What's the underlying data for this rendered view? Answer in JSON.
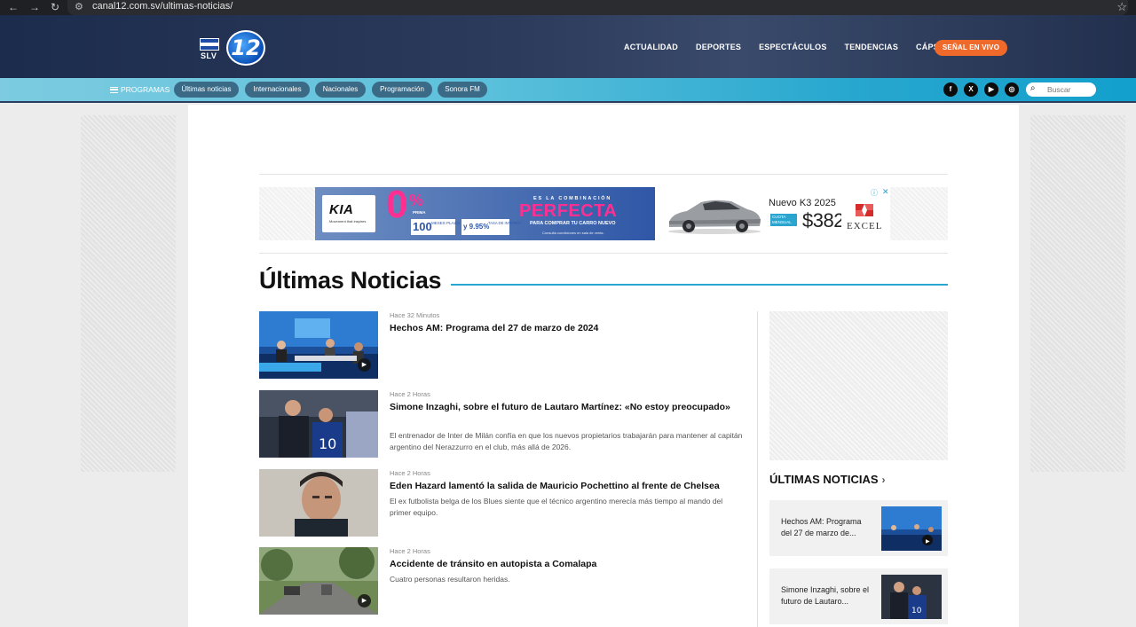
{
  "browser": {
    "url": "canal12.com.sv/ultimas-noticias/"
  },
  "header": {
    "flag_label": "SLV",
    "logo_text": "12",
    "nav": [
      "ACTUALIDAD",
      "DEPORTES",
      "ESPECTÁCULOS",
      "TENDENCIAS",
      "CÁPSULAS"
    ],
    "live_button": "SEÑAL EN VIVO"
  },
  "subnav": {
    "programas": "PROGRAMAS",
    "pills": [
      "Últimas noticias",
      "Internacionales",
      "Nacionales",
      "Programación",
      "Sonora FM"
    ],
    "social": [
      "facebook-icon",
      "x-icon",
      "youtube-icon",
      "instagram-icon"
    ],
    "search_placeholder": "Buscar"
  },
  "banner_ad": {
    "brand": "KIA",
    "brand_sub": "Movement that inspires",
    "zero": "0",
    "percent": "%",
    "prima": "PRIMA ",
    "cuotas": "100",
    "cuotas_sub": "MESES PLAZO",
    "tasa": "y 9.95%",
    "tasa_sub": "TASA DE INTERÉS",
    "es_la": "ES LA COMBINACIÓN",
    "perfecta": "PERFECTA",
    "comprar": "PARA COMPRAR TU CARRO NUEVO",
    "consulta": "Consulta condiciones en sala de venta.",
    "model": "Nuevo K3 2025",
    "cuota_tag": "CUOTA MENSUAL",
    "price": "$382",
    "dealer": "EXCEL"
  },
  "section": {
    "title": "Últimas Noticias"
  },
  "news": [
    {
      "meta": "Hace 32 Minutos",
      "title": "Hechos AM: Programa del 27 de marzo de 2024",
      "desc": ""
    },
    {
      "meta": "Hace 2 Horas",
      "title": "Simone Inzaghi, sobre el futuro de Lautaro Martínez: «No estoy preocupado»",
      "desc": "El entrenador de Inter de Milán confía en que los nuevos propietarios trabajarán para mantener al capitán argentino del Nerazzurro en el club, más allá de 2026."
    },
    {
      "meta": "Hace 2 Horas",
      "title": "Eden Hazard lamentó la salida de Mauricio Pochettino al frente de Chelsea",
      "desc": "El ex futbolista belga de los Blues siente que el técnico argentino merecía más tiempo al mando del primer equipo."
    },
    {
      "meta": "Hace 2 Horas",
      "title": "Accidente de tránsito en autopista a Comalapa",
      "desc": "Cuatro personas resultaron heridas."
    }
  ],
  "sidebar": {
    "heading": "ÚLTIMAS NOTICIAS",
    "chevron": "›",
    "cards": [
      {
        "title": "Hechos AM: Programa del 27 de marzo de..."
      },
      {
        "title": "Simone Inzaghi, sobre el futuro de Lautaro..."
      }
    ]
  },
  "colors": {
    "header_bg": "#2c3a5c",
    "subbar_bg": "#27a7cf",
    "accent_orange": "#ef6a2a",
    "accent_line": "#27a7cf"
  }
}
